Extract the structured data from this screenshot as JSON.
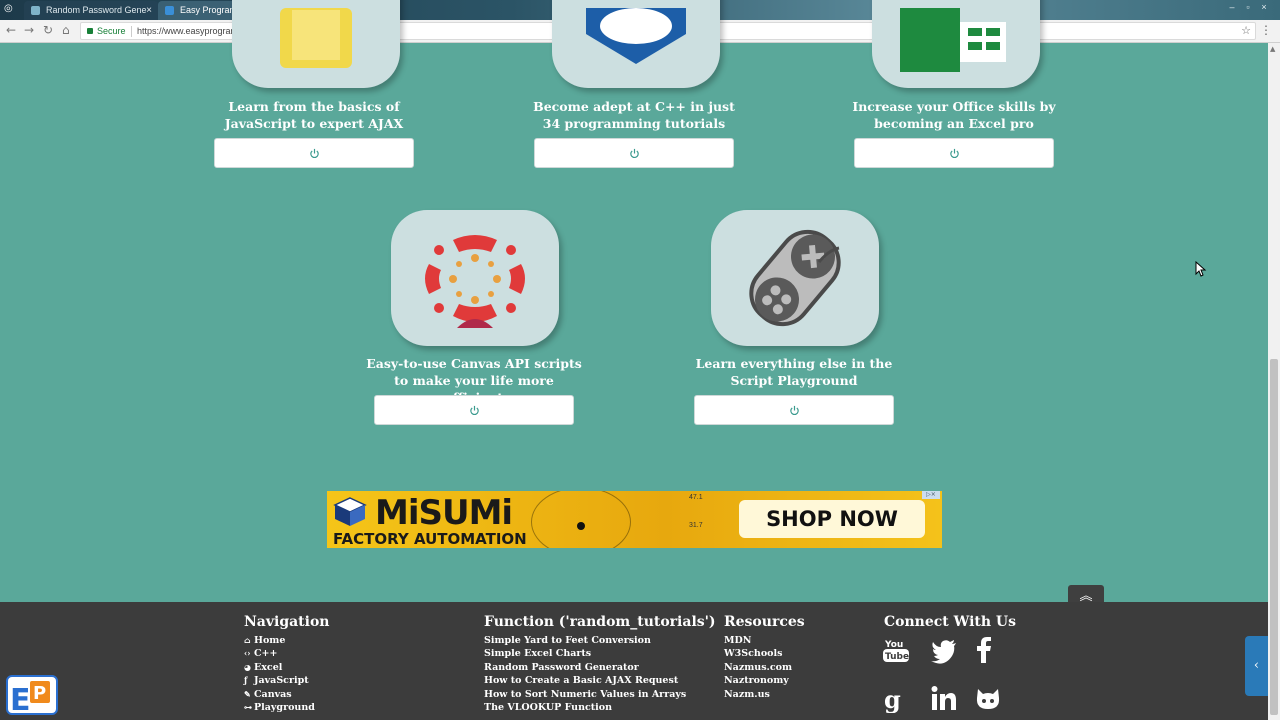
{
  "browser": {
    "tabs": [
      {
        "label": "Random Password Gene"
      },
      {
        "label": "Easy Programming - C"
      }
    ],
    "secure_label": "Secure",
    "url": "https://www.easyprogramming.net"
  },
  "cards_top": [
    {
      "desc": "Learn from the basics of JavaScript to expert AJAX"
    },
    {
      "desc": "Become adept at C++ in just 34 programming tutorials"
    },
    {
      "desc": "Increase your Office skills by becoming an Excel pro"
    }
  ],
  "cards_bottom": [
    {
      "desc": "Easy-to-use Canvas API scripts to make your life more efficient"
    },
    {
      "desc": "Learn everything else in the Script Playground"
    }
  ],
  "ad": {
    "brand": "MiSUMi",
    "subtitle": "FACTORY AUTOMATION",
    "cta": "SHOP NOW >>>",
    "num1": "47.1",
    "num2": "31.7"
  },
  "footer": {
    "navigation": {
      "heading": "Navigation",
      "items": [
        {
          "icon": "home-icon",
          "label": "Home"
        },
        {
          "icon": "code-icon",
          "label": "C++"
        },
        {
          "icon": "pie-chart-icon",
          "label": "Excel"
        },
        {
          "icon": "js-icon",
          "label": "JavaScript"
        },
        {
          "icon": "brush-icon",
          "label": "Canvas"
        },
        {
          "icon": "gamepad-icon",
          "label": "Playground"
        }
      ]
    },
    "functions": {
      "heading": "Function ('random_tutorials')",
      "items": [
        "Simple Yard to Feet Conversion",
        "Simple Excel Charts",
        "Random Password Generator",
        "How to Create a Basic AJAX Request",
        "How to Sort Numeric Values in Arrays",
        "The VLOOKUP Function"
      ]
    },
    "resources": {
      "heading": "Resources",
      "items": [
        "MDN",
        "W3Schools",
        "Nazmus.com",
        "Naztronomy",
        "Nazm.us"
      ]
    },
    "connect": {
      "heading": "Connect With Us",
      "icons": [
        "youtube-icon",
        "twitter-icon",
        "facebook-icon",
        "google-plus-icon",
        "linkedin-icon",
        "github-icon"
      ]
    }
  },
  "colors": {
    "page_bg": "#5aa89a",
    "footer_bg": "#3c3c3c",
    "card_bg": "#ccdfe0",
    "ad_yellow": "#f5c518"
  }
}
